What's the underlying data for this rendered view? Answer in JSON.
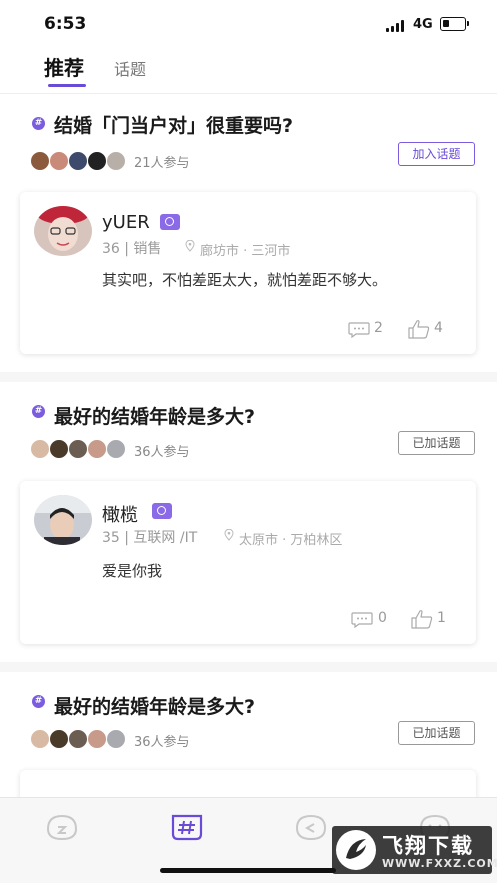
{
  "status_bar": {
    "time": "6:53",
    "network": "4G"
  },
  "tabs": [
    {
      "label": "推荐",
      "active": true
    },
    {
      "label": "话题",
      "active": false
    }
  ],
  "topics": [
    {
      "title": "结婚「门当户对」很重要吗?",
      "participants": "21人参与",
      "button_label": "加入话题",
      "joined": false,
      "post": {
        "name": "yUER",
        "age": "36",
        "job": "销售",
        "meta": "36 | 销售",
        "location": "廊坊市 · 三河市",
        "text": "其实吧，不怕差距太大，就怕差距不够大。",
        "comments": "2",
        "likes": "4"
      }
    },
    {
      "title": "最好的结婚年龄是多大?",
      "participants": "36人参与",
      "button_label": "已加话题",
      "joined": true,
      "post": {
        "name": "橄榄",
        "meta": "35 | 互联网 /IT",
        "location": "太原市 · 万柏林区",
        "text": "爱是你我",
        "comments": "0",
        "likes": "1"
      }
    },
    {
      "title": "最好的结婚年龄是多大?",
      "participants": "36人参与",
      "button_label": "已加话题",
      "joined": true
    }
  ],
  "bottom_nav": [
    {
      "icon": "home-icon",
      "active": false
    },
    {
      "icon": "topic-hash-icon",
      "active": true
    },
    {
      "icon": "message-icon",
      "active": false
    },
    {
      "icon": "profile-icon",
      "active": false
    }
  ],
  "watermark": {
    "text": "飞翔下载",
    "url": "WWW.FXXZ.COM"
  },
  "colors": {
    "accent": "#6a4bd8",
    "badge": "#8a6ae6"
  }
}
